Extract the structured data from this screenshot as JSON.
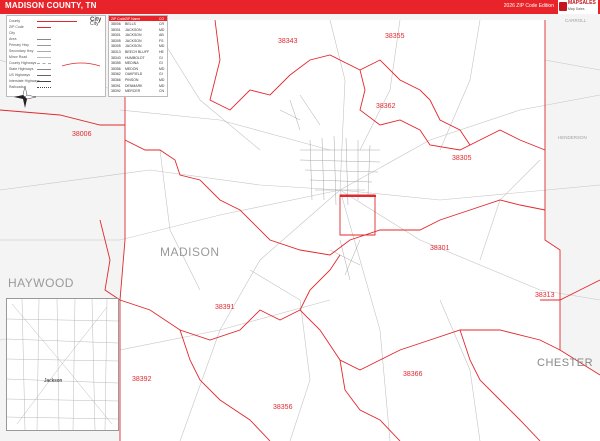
{
  "header": {
    "title": "MADISON COUNTY, TN",
    "edition": "2026 ZIP Code Edition"
  },
  "logo": {
    "brand": "MAPSALES",
    "sub": "Map Sales"
  },
  "map": {
    "boundary_color": "#e0282e",
    "road_color": "#bdbdbd",
    "neighbor_fill": "#f4f4f4",
    "zip_labels": [
      {
        "zip": "38343"
      },
      {
        "zip": "38355"
      },
      {
        "zip": "38362"
      },
      {
        "zip": "38006"
      },
      {
        "zip": "38305"
      },
      {
        "zip": "38301"
      },
      {
        "zip": "38313"
      },
      {
        "zip": "38391"
      },
      {
        "zip": "38392"
      },
      {
        "zip": "38366"
      },
      {
        "zip": "38356"
      }
    ],
    "county_labels": {
      "madison": "MADISON",
      "haywood": "HAYWOOD",
      "chester": "CHESTER",
      "henderson": "HENDERSON",
      "carroll": "CARROLL"
    },
    "inset_city": "Jackson"
  },
  "legend": {
    "city_key": [
      "City",
      "City"
    ],
    "rows": [
      {
        "label": "County"
      },
      {
        "label": "ZIP Code"
      },
      {
        "label": "City"
      },
      {
        "label": "Area"
      },
      {
        "label": "Primary Hwy"
      },
      {
        "label": "Secondary Hwy"
      },
      {
        "label": "Minor Road"
      },
      {
        "label": "County Highways"
      },
      {
        "label": "State Highways"
      },
      {
        "label": "US Highways"
      },
      {
        "label": "Interstate Highways"
      },
      {
        "label": "Railroads"
      }
    ]
  },
  "zip_table": {
    "headers": [
      "ZIP Code",
      "ZIP Name",
      "CO"
    ],
    "rows": [
      {
        "zip": "38006",
        "name": "BELLS",
        "co": "CR"
      },
      {
        "zip": "38301",
        "name": "JACKSON",
        "co": "MD"
      },
      {
        "zip": "38301",
        "name": "JACKSON",
        "co": "AB"
      },
      {
        "zip": "38305",
        "name": "JACKSON",
        "co": "FS"
      },
      {
        "zip": "38305",
        "name": "JACKSON",
        "co": "MD"
      },
      {
        "zip": "38313",
        "name": "BEECH BLUFF",
        "co": "HE"
      },
      {
        "zip": "38343",
        "name": "HUMBOLDT",
        "co": "GI"
      },
      {
        "zip": "38355",
        "name": "MEDINA",
        "co": "GI"
      },
      {
        "zip": "38356",
        "name": "MEDON",
        "co": "MD"
      },
      {
        "zip": "38362",
        "name": "OAKFIELD",
        "co": "GI"
      },
      {
        "zip": "38366",
        "name": "PINSON",
        "co": "MD"
      },
      {
        "zip": "38391",
        "name": "DENMARK",
        "co": "MD"
      },
      {
        "zip": "38392",
        "name": "MERCER",
        "co": "CN"
      }
    ]
  }
}
